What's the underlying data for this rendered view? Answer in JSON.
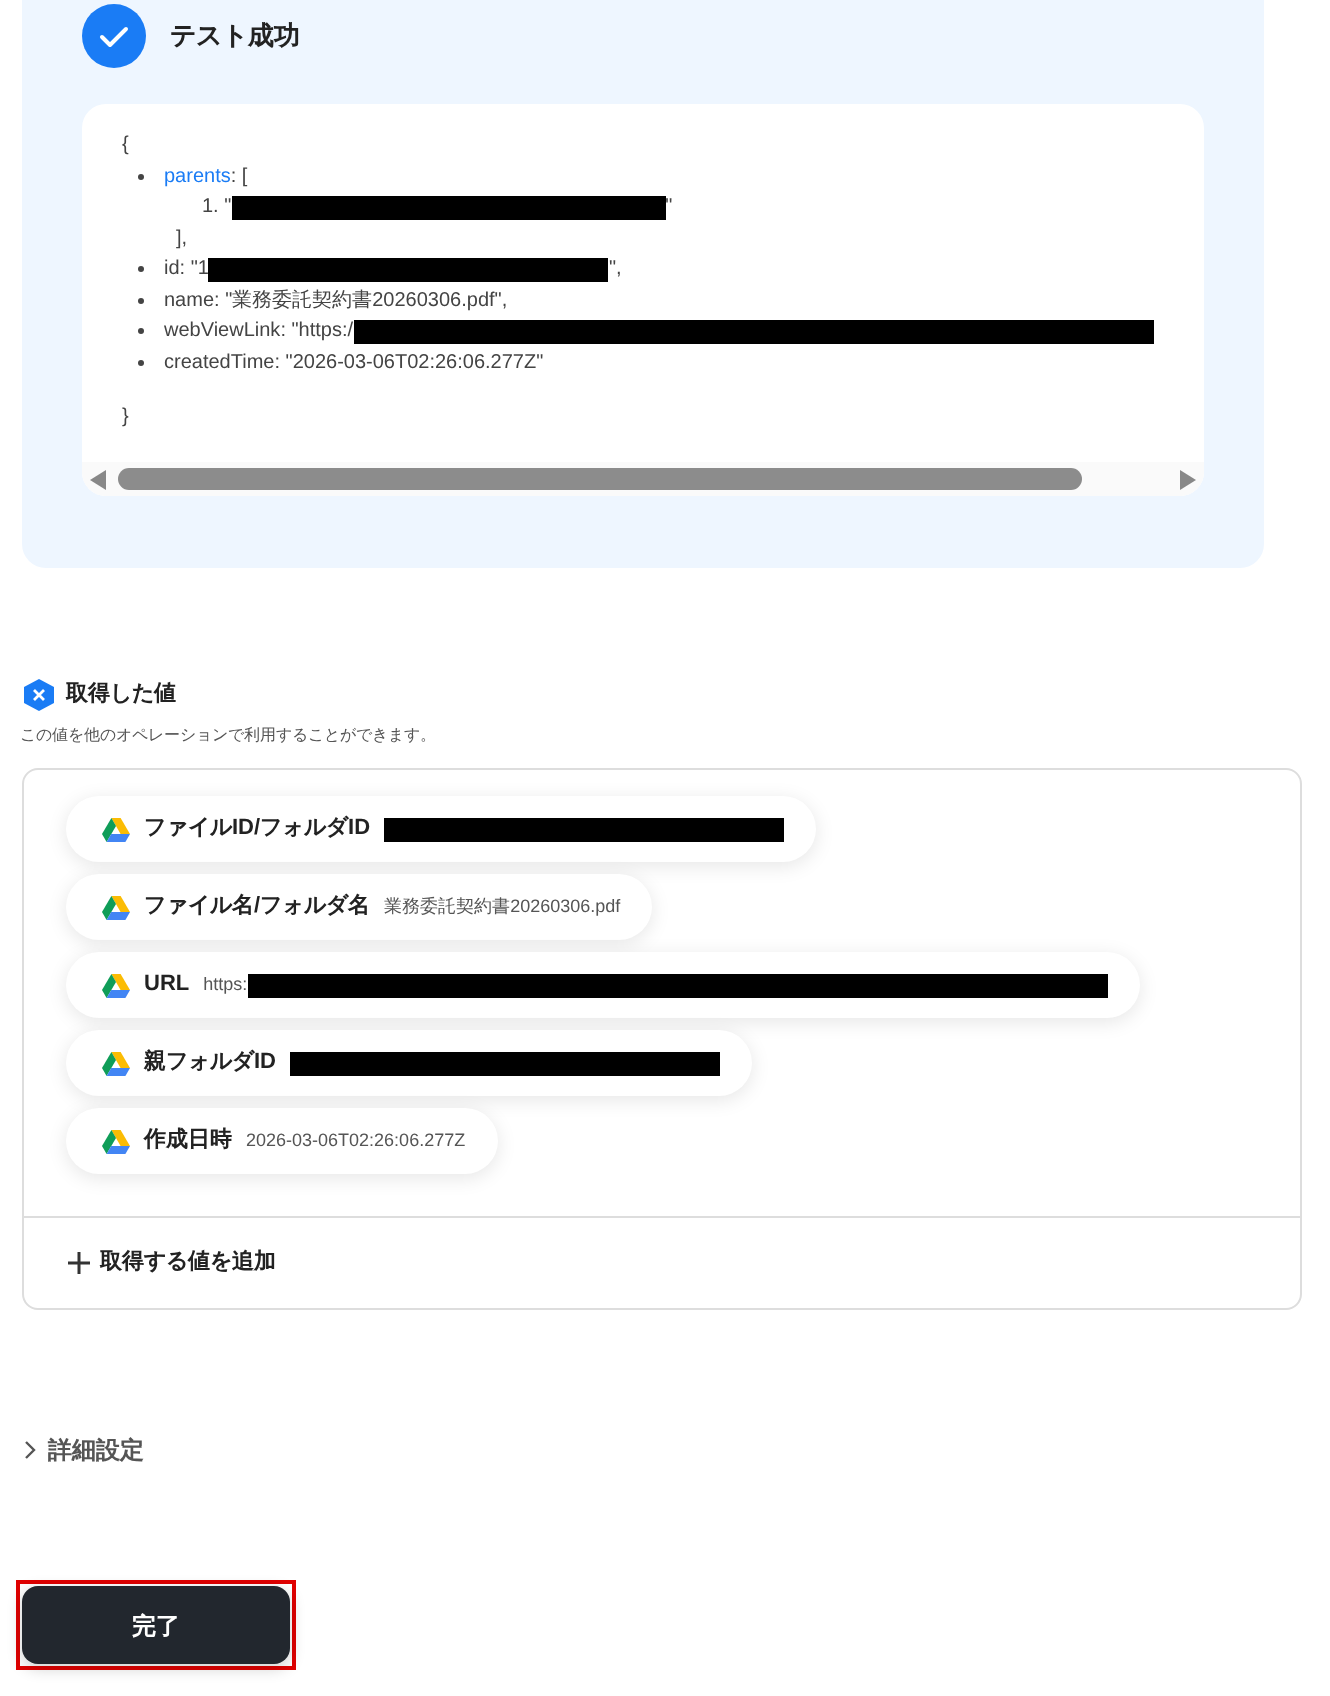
{
  "test_result": {
    "title": "テスト成功",
    "success": true,
    "code": {
      "open": "{",
      "close": "}",
      "entries": [
        {
          "key": "parents",
          "highlight_key": true,
          "rest": ": [",
          "items": [
            {
              "marker": "1.",
              "before": "\"",
              "redacted": true,
              "after": "\""
            }
          ],
          "closing": "],"
        },
        {
          "key": "id",
          "highlight_key": false,
          "rest": ": \"1",
          "redacted": true,
          "after": "\","
        },
        {
          "key": "name",
          "highlight_key": false,
          "rest": ": \"業務委託契約書20260306.pdf\","
        },
        {
          "key": "webViewLink",
          "highlight_key": false,
          "rest": ": \"https:/",
          "redacted": true
        },
        {
          "key": "createdTime",
          "highlight_key": false,
          "rest": ": \"2026-03-06T02:26:06.277Z\""
        }
      ]
    }
  },
  "outputs": {
    "title": "取得した値",
    "description": "この値を他のオペレーションで利用することができます。",
    "items": [
      {
        "label": "ファイルID/フォルダID",
        "redacted": true
      },
      {
        "label": "ファイル名/フォルダ名",
        "value": "業務委託契約書20260306.pdf"
      },
      {
        "label": "URL",
        "value": "https:",
        "redacted": true
      },
      {
        "label": "親フォルダID",
        "redacted": true
      },
      {
        "label": "作成日時",
        "value": "2026-03-06T02:26:06.277Z"
      }
    ],
    "add_label": "取得する値を追加"
  },
  "advanced": {
    "label": "詳細設定",
    "expanded": false
  },
  "done_button": {
    "label": "完了",
    "highlighted": true
  }
}
